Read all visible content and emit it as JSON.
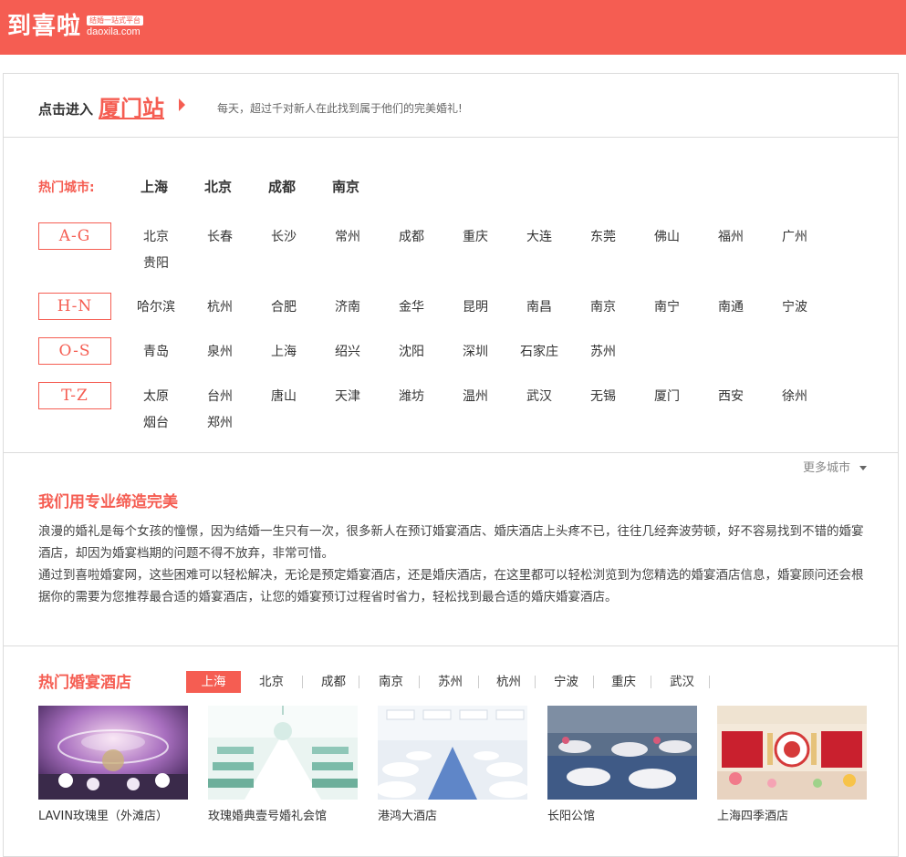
{
  "header": {
    "logo_text": "到喜啦",
    "logo_badge": "结婚一站式平台",
    "logo_domain": "daoxila.com"
  },
  "enter": {
    "label": "点击进入",
    "city": "厦门站",
    "slogan": "每天，超过千对新人在此找到属于他们的完美婚礼!"
  },
  "hot": {
    "label": "热门城市:",
    "cities": [
      "上海",
      "北京",
      "成都",
      "南京"
    ]
  },
  "groups": [
    {
      "tag": "A-G",
      "cities": [
        "北京",
        "长春",
        "长沙",
        "常州",
        "成都",
        "重庆",
        "大连",
        "东莞",
        "佛山",
        "福州",
        "广州",
        "贵阳"
      ]
    },
    {
      "tag": "H-N",
      "cities": [
        "哈尔滨",
        "杭州",
        "合肥",
        "济南",
        "金华",
        "昆明",
        "南昌",
        "南京",
        "南宁",
        "南通",
        "宁波"
      ]
    },
    {
      "tag": "O-S",
      "cities": [
        "青岛",
        "泉州",
        "上海",
        "绍兴",
        "沈阳",
        "深圳",
        "石家庄",
        "苏州"
      ]
    },
    {
      "tag": "T-Z",
      "cities": [
        "太原",
        "台州",
        "唐山",
        "天津",
        "潍坊",
        "温州",
        "武汉",
        "无锡",
        "厦门",
        "西安",
        "徐州",
        "烟台",
        "郑州"
      ]
    }
  ],
  "more_cities": "更多城市",
  "intro": {
    "title": "我们用专业缔造完美",
    "para1": "浪漫的婚礼是每个女孩的憧憬，因为结婚一生只有一次，很多新人在预订婚宴酒店、婚庆酒店上头疼不已，往往几经奔波劳顿，好不容易找到不错的婚宴酒店，却因为婚宴档期的问题不得不放弃，非常可惜。",
    "para2": "通过到喜啦婚宴网，这些困难可以轻松解决，无论是预定婚宴酒店，还是婚庆酒店，在这里都可以轻松浏览到为您精选的婚宴酒店信息，婚宴顾问还会根据你的需要为您推荐最合适的婚宴酒店，让您的婚宴预订过程省时省力，轻松找到最合适的婚庆婚宴酒店。"
  },
  "hotels_section": {
    "title": "热门婚宴酒店",
    "tabs": [
      "上海",
      "北京",
      "成都",
      "南京",
      "苏州",
      "杭州",
      "宁波",
      "重庆",
      "武汉"
    ],
    "hotels": [
      {
        "name": "LAVIN玫瑰里（外滩店）"
      },
      {
        "name": "玫瑰婚典壹号婚礼会馆"
      },
      {
        "name": "港鸿大酒店"
      },
      {
        "name": "长阳公馆"
      },
      {
        "name": "上海四季酒店"
      }
    ]
  },
  "colors": {
    "brand": "#f55d52"
  }
}
